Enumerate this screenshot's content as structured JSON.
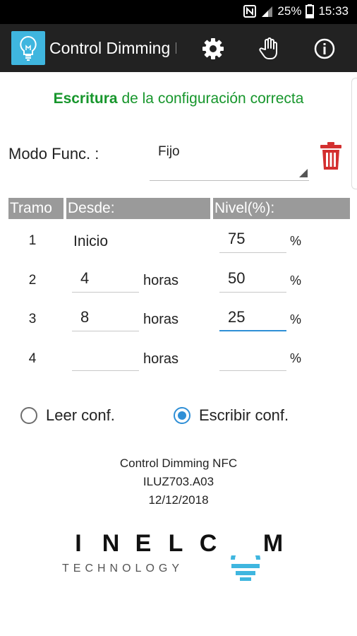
{
  "status_bar": {
    "battery": "25%",
    "time": "15:33"
  },
  "app_bar": {
    "title": "Control Dimming NFC",
    "icons": [
      "lightbulb-icon",
      "gear-icon",
      "hand-pointer-icon",
      "info-icon"
    ]
  },
  "status_message": {
    "bold": "Escritura",
    "rest": " de la configuración correcta",
    "color": "#17962c"
  },
  "modo": {
    "label": "Modo Func. :",
    "value": "Fijo"
  },
  "table": {
    "headers": {
      "tramo": "Tramo",
      "desde": "Desde:",
      "nivel": "Nivel(%):"
    },
    "rows": [
      {
        "num": "1",
        "desde": "Inicio",
        "horas": "",
        "nivel": "75",
        "pct": "%"
      },
      {
        "num": "2",
        "desde": "4",
        "horas": "horas",
        "nivel": "50",
        "pct": "%"
      },
      {
        "num": "3",
        "desde": "8",
        "horas": "horas",
        "nivel": "25",
        "pct": "%"
      },
      {
        "num": "4",
        "desde": "",
        "horas": "horas",
        "nivel": "",
        "pct": "%"
      }
    ]
  },
  "radios": [
    {
      "label": "Leer conf.",
      "selected": false
    },
    {
      "label": "Escribir conf.",
      "selected": true
    }
  ],
  "info": {
    "line1": "Control Dimming NFC",
    "line2": "ILUZ703.A03",
    "line3": "12/12/2018"
  },
  "brand": {
    "name": "INELCOM",
    "sub": "TECHNOLOGY",
    "accent": "#3fb6df"
  },
  "colors": {
    "accent": "#2f8fd6",
    "delete": "#d32f2f",
    "header_bg": "#9a9a9a"
  }
}
